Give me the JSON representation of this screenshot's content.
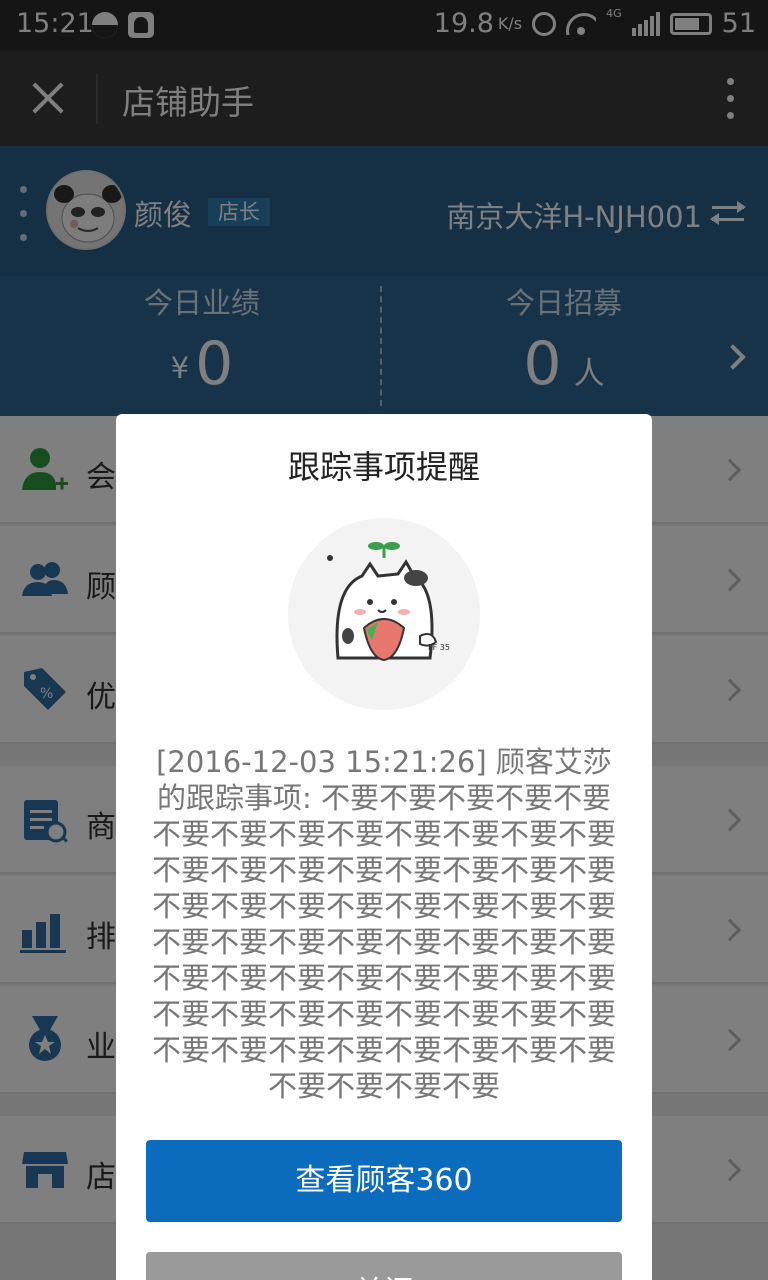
{
  "status_bar": {
    "time": "15:21",
    "net_speed": "19.8",
    "net_speed_unit": "K/s",
    "network_type": "4G",
    "battery": "51"
  },
  "app_bar": {
    "title": "店铺助手",
    "close_icon": "close-icon",
    "more_icon": "more-vert-icon"
  },
  "profile": {
    "name": "颜俊",
    "role": "店长",
    "store": "南京大洋H-NJH001"
  },
  "stats": {
    "today_sales_label": "今日业绩",
    "today_sales_prefix": "¥",
    "today_sales_value": "0",
    "today_recruit_label": "今日招募",
    "today_recruit_value": "0",
    "today_recruit_unit": "人"
  },
  "menu": {
    "items": [
      {
        "label": "会",
        "icon": "add-member-icon"
      },
      {
        "label": "顾",
        "icon": "customers-icon"
      },
      {
        "label": "优",
        "icon": "coupon-tag-icon"
      },
      {
        "label": "商",
        "icon": "goods-search-icon"
      },
      {
        "label": "排",
        "icon": "ranking-bars-icon"
      },
      {
        "label": "业",
        "icon": "medal-icon"
      },
      {
        "label": "店",
        "icon": "store-icon"
      }
    ]
  },
  "dialog": {
    "title": "跟踪事项提醒",
    "message": "[2016-12-03 15:21:26] 顾客艾莎的跟踪事项: 不要不要不要不要不要不要不要不要不要不要不要不要不要不要不要不要不要不要不要不要不要不要不要不要不要不要不要不要不要不要不要不要不要不要不要不要不要不要不要不要不要不要不要不要不要不要不要不要不要不要不要不要不要不要不要不要不要不要不要不要不要不要不要不要不要",
    "primary_button": "查看顾客360",
    "secondary_button": "关闭"
  },
  "colors": {
    "header_blue": "#2f6695",
    "primary_button": "#0b6bbd",
    "menu_icon_blue": "#2f6ea5",
    "menu_icon_green": "#2e9a3e"
  }
}
